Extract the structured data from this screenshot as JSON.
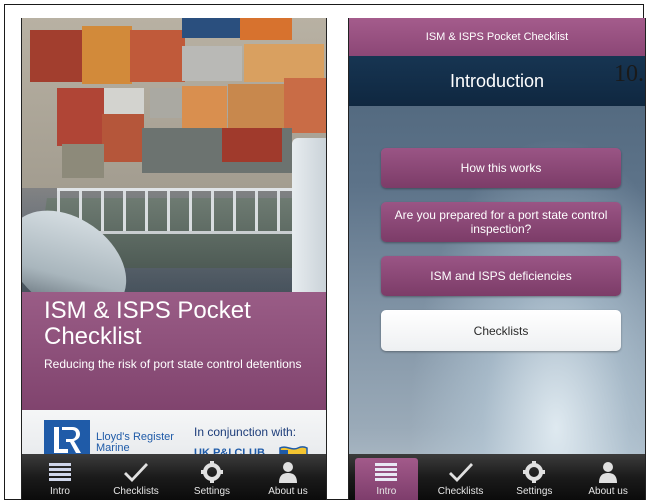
{
  "left_screen": {
    "app_title": "ISM & ISPS Pocket Checklist",
    "tagline": "Reducing the risk of port state control detentions",
    "sponsor": {
      "lr_name": "Lloyd's Register Marine",
      "conjunction_text": "In conjunction with:",
      "club_name": "UK P&I CLUB"
    }
  },
  "right_screen": {
    "header_title": "ISM & ISPS Pocket Checklist",
    "nav_title": "Introduction",
    "page_number": "10.",
    "buttons": [
      {
        "label": "How this works"
      },
      {
        "label": "Are you prepared for a port state control inspection?"
      },
      {
        "label": "ISM and ISPS deficiencies"
      },
      {
        "label": "Checklists"
      }
    ]
  },
  "tabs": [
    {
      "label": "Intro",
      "icon": "list-icon"
    },
    {
      "label": "Checklists",
      "icon": "checkmark-icon"
    },
    {
      "label": "Settings",
      "icon": "gear-icon"
    },
    {
      "label": "About us",
      "icon": "person-icon"
    }
  ],
  "colors": {
    "accent_purple": "#8c4776",
    "nav_navy": "#173552",
    "lr_blue": "#1f5ba8"
  }
}
